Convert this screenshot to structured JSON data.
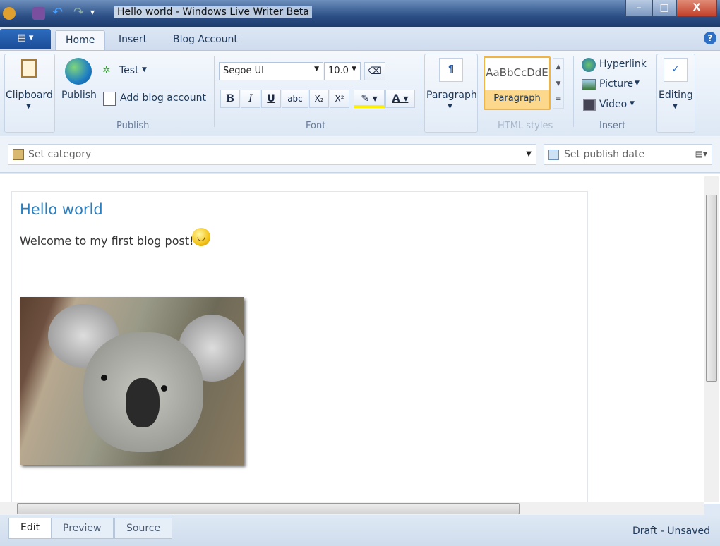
{
  "window": {
    "title": "Hello world - Windows Live Writer Beta",
    "minimize": "–",
    "maximize": "□",
    "close": "X"
  },
  "tabs": [
    "Home",
    "Insert",
    "Blog Account"
  ],
  "help": "?",
  "clipboard": {
    "label": "Clipboard"
  },
  "publish": {
    "publish": "Publish",
    "test": "Test",
    "add_account": "Add blog account",
    "group": "Publish"
  },
  "font": {
    "family": "Segoe UI",
    "size": "10.0",
    "bold": "B",
    "italic": "I",
    "underline": "U",
    "strike": "abc",
    "sub": "X₂",
    "sup": "X²",
    "color": "A",
    "group": "Font"
  },
  "paragraph": {
    "label": "Paragraph"
  },
  "styles": {
    "preview": "AaBbCcDdE",
    "name": "Paragraph",
    "group": "HTML styles"
  },
  "insert": {
    "hyperlink": "Hyperlink",
    "picture": "Picture",
    "video": "Video",
    "group": "Insert"
  },
  "editing": {
    "label": "Editing"
  },
  "category": {
    "placeholder": "Set category",
    "date": "Set publish date"
  },
  "post": {
    "title": "Hello world",
    "body": "Welcome to my first blog post!"
  },
  "view_tabs": [
    "Edit",
    "Preview",
    "Source"
  ],
  "status": "Draft - Unsaved"
}
